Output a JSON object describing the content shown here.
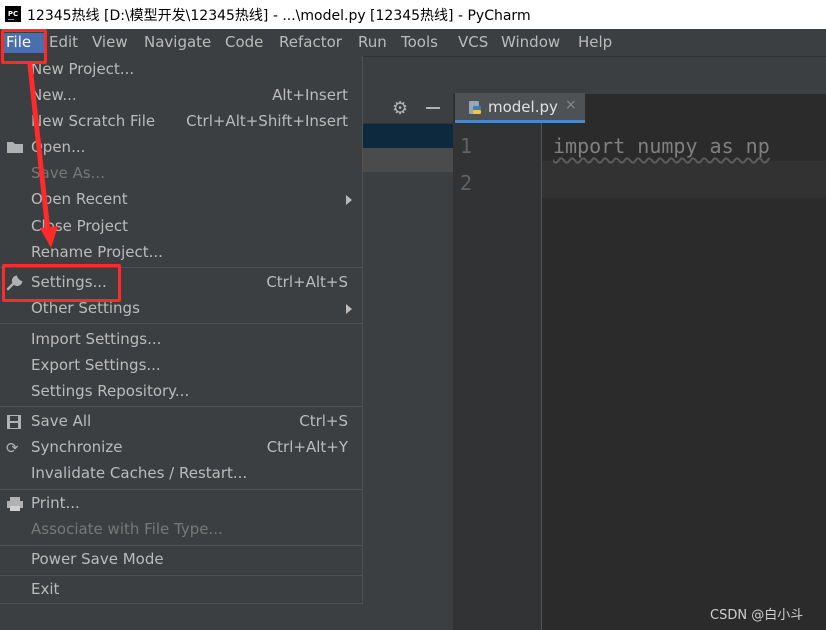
{
  "window": {
    "title": "12345热线 [D:\\模型开发\\12345热线] - ...\\model.py [12345热线] - PyCharm"
  },
  "menubar": [
    "File",
    "Edit",
    "View",
    "Navigate",
    "Code",
    "Refactor",
    "Run",
    "Tools",
    "VCS",
    "Window",
    "Help"
  ],
  "tab": {
    "label": "model.py",
    "close": "×"
  },
  "editor": {
    "line_numbers": [
      "1",
      "2"
    ],
    "code_line1": "import numpy as np"
  },
  "file_menu": {
    "items": [
      {
        "label": "New Project...",
        "shortcut": ""
      },
      {
        "label": "New...",
        "shortcut": "Alt+Insert"
      },
      {
        "label": "New Scratch File",
        "shortcut": "Ctrl+Alt+Shift+Insert"
      },
      {
        "label": "Open...",
        "shortcut": ""
      },
      {
        "label": "Save As...",
        "shortcut": ""
      },
      {
        "label": "Open Recent",
        "shortcut": ""
      },
      {
        "label": "Close Project",
        "shortcut": ""
      },
      {
        "label": "Rename Project...",
        "shortcut": ""
      },
      {
        "label": "Settings...",
        "shortcut": "Ctrl+Alt+S"
      },
      {
        "label": "Other Settings",
        "shortcut": ""
      },
      {
        "label": "Import Settings...",
        "shortcut": ""
      },
      {
        "label": "Export Settings...",
        "shortcut": ""
      },
      {
        "label": "Settings Repository...",
        "shortcut": ""
      },
      {
        "label": "Save All",
        "shortcut": "Ctrl+S"
      },
      {
        "label": "Synchronize",
        "shortcut": "Ctrl+Alt+Y"
      },
      {
        "label": "Invalidate Caches / Restart...",
        "shortcut": ""
      },
      {
        "label": "Print...",
        "shortcut": ""
      },
      {
        "label": "Associate with File Type...",
        "shortcut": ""
      },
      {
        "label": "Power Save Mode",
        "shortcut": ""
      },
      {
        "label": "Exit",
        "shortcut": ""
      }
    ]
  },
  "watermark": "CSDN @白小斗",
  "colors": {
    "accent": "#4b6eaf",
    "annotation": "#ff2a2a",
    "menu_bg": "#3c3f41"
  }
}
